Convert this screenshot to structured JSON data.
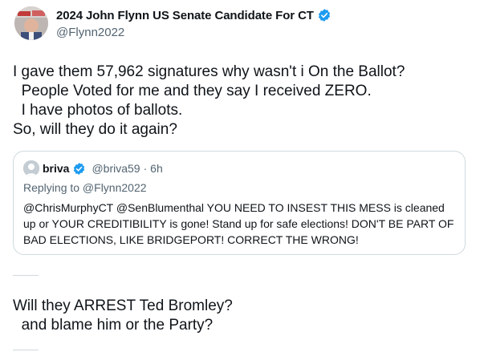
{
  "tweet": {
    "author": {
      "display_name": "2024 John Flynn US Senate Candidate For CT",
      "handle": "@Flynn2022",
      "verified_icon": "verified-badge-icon",
      "verified_color": "#1d9bf0"
    },
    "text": "I gave them 57,962 signatures why wasn't i On the Ballot?\n  People Voted for me and they say I received ZERO.\n  I have photos of ballots.\nSo, will they do it again?"
  },
  "quote": {
    "display_name": "briva",
    "handle": "@briva59",
    "time": "· 6h",
    "replying_to": "Replying to @Flynn2022",
    "text": "@ChrisMurphyCT @SenBlumenthal YOU NEED TO INSEST THIS MESS is cleaned up or YOUR CREDITIBILITY is gone! Stand up for safe elections! DON'T BE PART OF BAD ELECTIONS, LIKE BRIDGEPORT! CORRECT THE WRONG!"
  },
  "followup": {
    "text": "Will they ARREST Ted Bromley?\n  and blame him or the Party?"
  }
}
